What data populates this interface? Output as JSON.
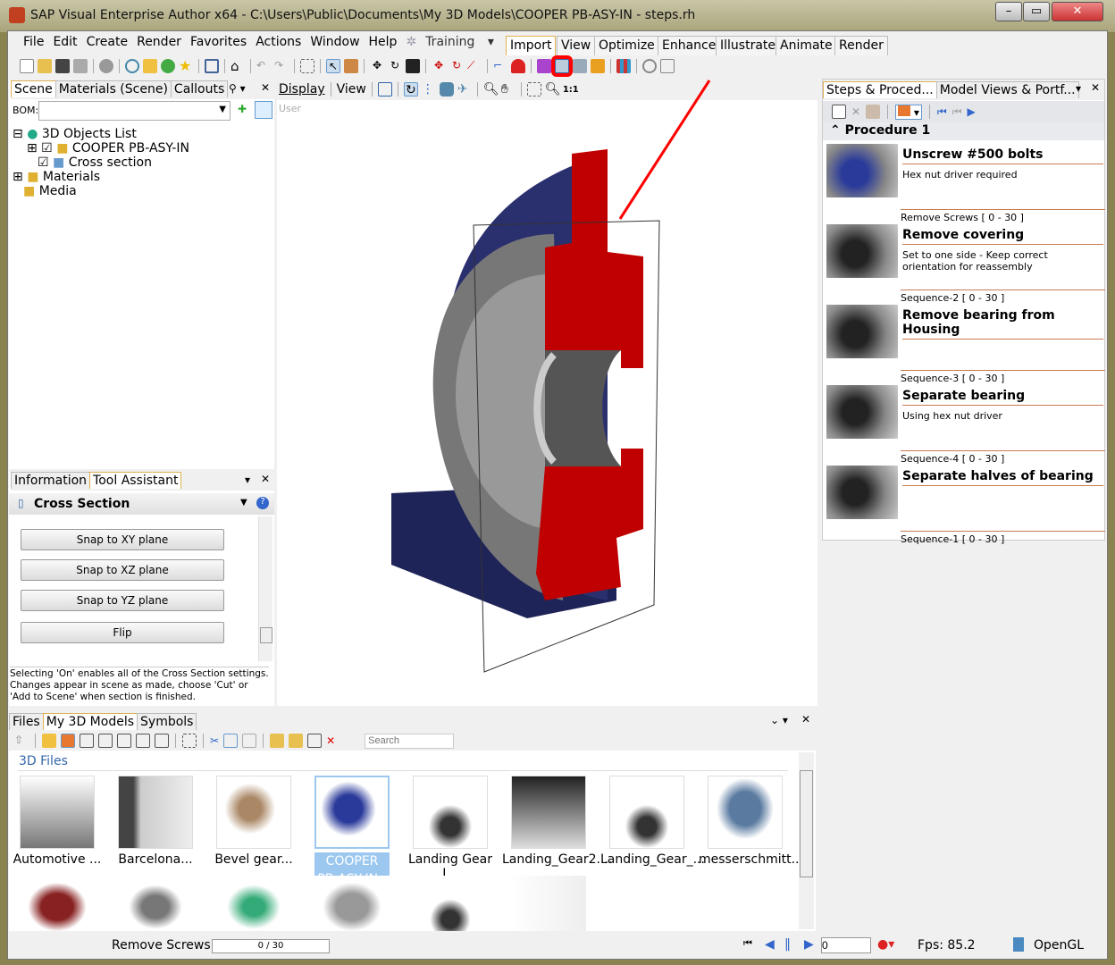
{
  "window": {
    "title": "SAP Visual Enterprise Author x64 - C:\\Users\\Public\\Documents\\My 3D Models\\COOPER PB-ASY-IN - steps.rh"
  },
  "menu": [
    "File",
    "Edit",
    "Create",
    "Render",
    "Favorites",
    "Actions",
    "Window",
    "Help"
  ],
  "training": "Training",
  "ribbon_tabs": [
    "Import",
    "View",
    "Optimize",
    "Enhance",
    "Illustrate",
    "Animate",
    "Render"
  ],
  "left": {
    "tabs": [
      "Scene",
      "Materials (Scene)",
      "Callouts"
    ],
    "bom_label": "BOM:",
    "user_label": "User",
    "tree": [
      {
        "label": "3D Objects List"
      },
      {
        "label": "COOPER PB-ASY-IN"
      },
      {
        "label": "Cross section"
      },
      {
        "label": "Materials"
      },
      {
        "label": "Media"
      }
    ]
  },
  "view_toolbar": {
    "display": "Display",
    "view": "View",
    "zoom_label": "1:1"
  },
  "info": {
    "tabs": [
      "Information",
      "Tool Assistant"
    ],
    "title": "Cross Section",
    "buttons": [
      "Snap to XY plane",
      "Snap to XZ plane",
      "Snap to YZ plane",
      "Flip"
    ],
    "help": "Selecting 'On' enables all of the Cross Section settings. Changes appear in scene as made, choose 'Cut' or 'Add to Scene' when section is finished."
  },
  "steps": {
    "tabs": [
      "Steps & Proced...",
      "Model Views & Portf..."
    ],
    "procedure": "Procedure 1",
    "items": [
      {
        "name": "Unscrew #500 bolts",
        "desc": "Hex nut driver required",
        "seq": "Remove Screws [ 0 - 30 ]"
      },
      {
        "name": "Remove covering",
        "desc": "Set to one side - Keep correct orientation for reassembly",
        "seq": "Sequence-2 [ 0 - 30 ]"
      },
      {
        "name": "Remove bearing from Housing",
        "desc": "",
        "seq": "Sequence-3 [ 0 - 30 ]"
      },
      {
        "name": "Separate bearing",
        "desc": "Using hex nut driver",
        "seq": "Sequence-4 [ 0 - 30 ]"
      },
      {
        "name": "Separate halves of bearing",
        "desc": "",
        "seq": "Sequence-1 [ 0 - 30 ]"
      }
    ]
  },
  "files": {
    "tabs": [
      "Files",
      "My 3D Models",
      "Symbols"
    ],
    "search_placeholder": "Search",
    "section": "3D Files",
    "items": [
      "Automotive ...",
      "Barcelona...",
      "Bevel gear...",
      "COOPER PB-ASY-IN -",
      "Landing Gear I...",
      "Landing_Gear2....",
      "Landing_Gear_...",
      "messerschmitt...."
    ]
  },
  "status": {
    "sequence": "Remove Screws",
    "frame": "0 / 30",
    "time": "0",
    "fps": "Fps: 85.2",
    "renderer": "OpenGL"
  },
  "colors": {
    "highlight": "#ff0000",
    "selection": "#9cc8ef",
    "section_red": "#c00000",
    "housing_blue": "#2a2f6e"
  }
}
